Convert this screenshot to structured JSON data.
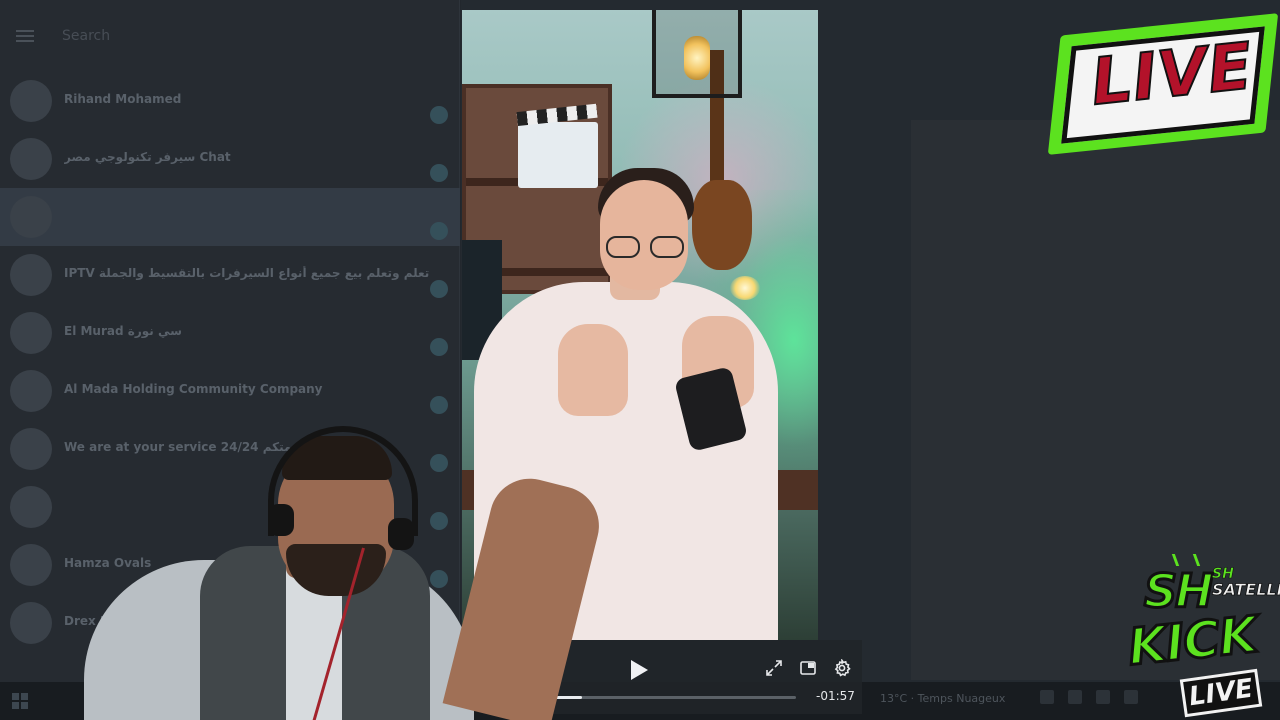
{
  "background_app": {
    "search_placeholder": "Search",
    "chats": [
      {
        "name": "Rihand Mohamed",
        "preview": "",
        "time": ""
      },
      {
        "name": "سيرفر تكنولوجي مصر Chat",
        "preview": "",
        "time": ""
      },
      {
        "name": "",
        "preview": "",
        "time": "",
        "active": true
      },
      {
        "name": "IPTV تعلم وتعلم بيع جميع أنواع السيرفرات بالتقسيط والجملة",
        "preview": "",
        "time": ""
      },
      {
        "name": "El Murad سي نورة",
        "preview": "",
        "time": ""
      },
      {
        "name": "Al Mada Holding Community Company",
        "preview": "",
        "time": ""
      },
      {
        "name": "We are at your service 24/24 خدمتكم",
        "preview": "",
        "time": ""
      },
      {
        "name": "",
        "preview": "",
        "time": ""
      },
      {
        "name": "Hamza Ovals",
        "preview": "",
        "time": ""
      },
      {
        "name": "Drex NEWS",
        "preview": "",
        "time": ""
      }
    ],
    "taskbar": {
      "weather": "13°C · Temps Nuageux"
    }
  },
  "video_player": {
    "time_remaining": "-01:57",
    "time_elapsed_fragment": "7",
    "progress": 0.35,
    "controls": {
      "play": "play-icon",
      "expand": "expand-icon",
      "pip": "picture-in-picture-icon",
      "settings": "gear-icon"
    }
  },
  "overlays": {
    "live_badge": "LIVE",
    "brand_mark": "SH",
    "brand_small": "SH",
    "brand_sub": "SATELLITE",
    "kick_text": "KICK",
    "kick_live": "LIVE"
  },
  "colors": {
    "live_green": "#5ce21f",
    "live_red": "#b3122a"
  }
}
